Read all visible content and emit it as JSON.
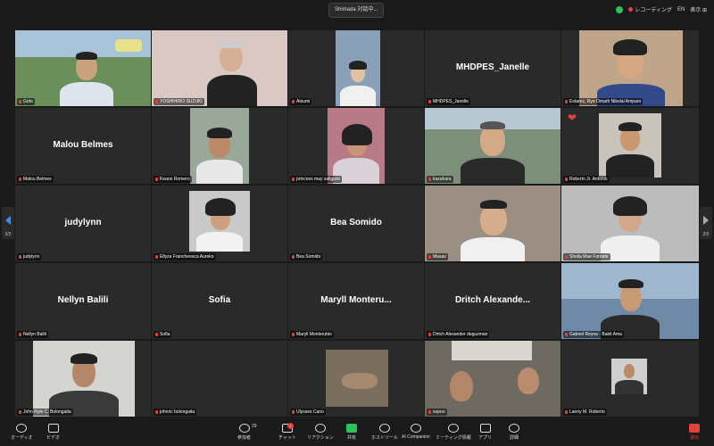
{
  "top": {
    "speaking": "Shimada 対話中...",
    "recording": "レコーディング",
    "lang": "EN",
    "view": "表示 ⊞"
  },
  "nav": {
    "left_page": "2/2",
    "right_page": "2/2"
  },
  "tiles": [
    {
      "label": "Goto"
    },
    {
      "label": "YOSHIHIRO SUZUKI"
    },
    {
      "label": "Atsumi"
    },
    {
      "label": "MHDPES_Janelle",
      "name": "MHDPES_Janelle"
    },
    {
      "label": "Estarez, Ryo Omarh Nikolai Amparo"
    },
    {
      "label": "Malou Belmes",
      "name": "Malou Belmes"
    },
    {
      "label": "Keano Romero"
    },
    {
      "label": "princess may saligudo"
    },
    {
      "label": "kazuhara"
    },
    {
      "label": "Roberto Jr. Antonio"
    },
    {
      "label": "judylynn",
      "name": "judylynn"
    },
    {
      "label": "Ellyza Francheesca Aureko"
    },
    {
      "label": "Bea Somido",
      "name": "Bea Somido"
    },
    {
      "label": "Masao"
    },
    {
      "label": "Sheila Mae Fornate"
    },
    {
      "label": "Nellyn Balili",
      "name": "Nellyn Balili"
    },
    {
      "label": "Sofia",
      "name": "Sofia"
    },
    {
      "label": "Maryll Monterubio",
      "name": "Maryll  Monteru..."
    },
    {
      "label": "Dritch Alexander deguzman",
      "name": "Dritch  Alexande..."
    },
    {
      "label": "Gabriel Reyna - Bakit Ama"
    },
    {
      "label": "John Ryle C. Bolongaita"
    },
    {
      "label": "johnric bolongaita"
    },
    {
      "label": "Ulysses Cano"
    },
    {
      "label": "sopoo"
    },
    {
      "label": "Lanny M. Roberto"
    }
  ],
  "toolbar": {
    "mic": "オーディオ",
    "video": "ビデオ",
    "participants": "参加者",
    "participants_count": "29",
    "chat": "チャット",
    "chat_badge": "1",
    "react": "リアクション",
    "share": "共有",
    "host": "ホストツール",
    "ai": "AI Companion",
    "info": "ミーティング情報",
    "apps": "アプリ",
    "more": "詳細",
    "leave": "退出"
  }
}
